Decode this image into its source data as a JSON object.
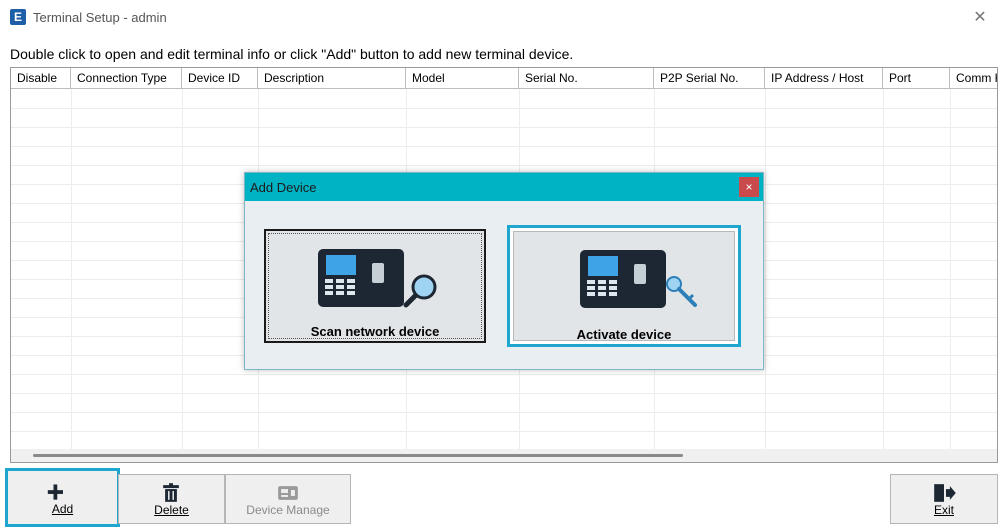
{
  "window": {
    "app_icon_letter": "E",
    "title": "Terminal Setup - admin",
    "close_glyph": "✕"
  },
  "instruction": "Double click to open and edit terminal info or click \"Add\" button to add new terminal device.",
  "grid": {
    "columns": [
      "Disable",
      "Connection Type",
      "Device ID",
      "Description",
      "Model",
      "Serial No.",
      "P2P Serial No.",
      "IP Address / Host",
      "Port",
      "Comm K"
    ]
  },
  "dialog": {
    "title": "Add Device",
    "close_glyph": "×",
    "scan_label": "Scan network device",
    "activate_label": "Activate device"
  },
  "toolbar": {
    "add_label": "Add",
    "delete_label": "Delete",
    "device_manage_label": "Device Manage",
    "exit_label": "Exit"
  },
  "colors": {
    "dialog_title": "#00b3c4",
    "focus_border": "#1fa6cf",
    "close_red": "#c84a4a"
  }
}
